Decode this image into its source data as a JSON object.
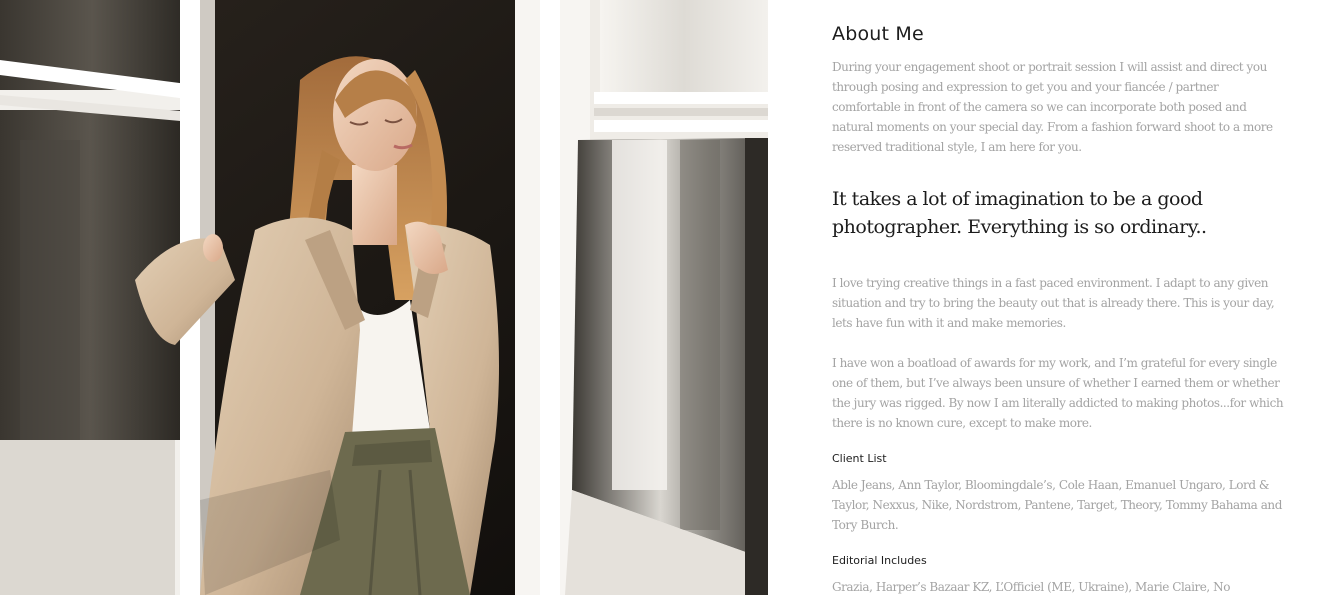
{
  "photo": {
    "alt": "Portrait of a woman in a beige trench coat standing in sunlight by an open window"
  },
  "about": {
    "title": "About Me",
    "intro": "During your engagement shoot or portrait session I will assist and direct you through posing and expression to get you and your fiancée / partner comfortable in front of the camera so we can incorporate both posed and natural moments on your special day. From a fashion forward shoot to a more reserved traditional style, I am here for you.",
    "quote": "It takes a lot of imagination to be a good photographer. Everything is so ordinary..",
    "creative": "I love trying creative things in a fast paced environment. I adapt to any given situation and try to bring the beauty out that is already there. This is your day, lets have fun with it and make memories.",
    "awards": "I have won a boatload of awards for my work, and I’m grateful for every single one of them, but I’ve always been unsure of whether I earned them or whether the jury was rigged.  By now I am literally addicted to making photos...for which there is no known cure, except to make more.",
    "clients_title": "Client List",
    "clients": "Able Jeans, Ann Taylor, Bloomingdale’s, Cole Haan, Emanuel Ungaro, Lord & Taylor, Nexxus, Nike, Nordstrom, Pantene, Target, Theory, Tommy Bahama and Tory Burch.",
    "editorial_title": "Editorial Includes",
    "editorial": "Grazia, Harper’s Bazaar KZ, L’Officiel (ME, Ukraine), Marie Claire, No"
  },
  "colors": {
    "heading": "#1d1d1d",
    "body_text": "#a3a3a3",
    "background": "#ffffff"
  }
}
